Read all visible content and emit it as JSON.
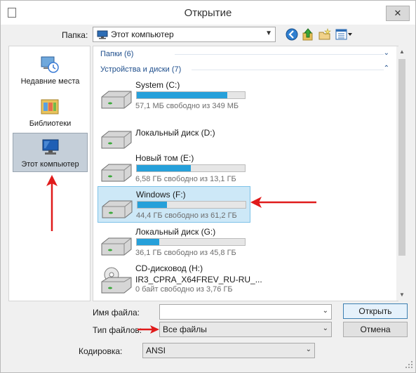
{
  "window": {
    "title": "Открытие",
    "close_label": "✕"
  },
  "location": {
    "label": "Папка:",
    "value": "Этот компьютер"
  },
  "toolbar": {
    "icons": [
      "back-icon",
      "up-folder-icon",
      "new-folder-icon",
      "view-menu-icon"
    ]
  },
  "places": [
    {
      "label": "Недавние места",
      "icon": "recent-places-icon",
      "selected": false
    },
    {
      "label": "Библиотеки",
      "icon": "libraries-icon",
      "selected": false
    },
    {
      "label": "Этот компьютер",
      "icon": "computer-icon",
      "selected": true
    }
  ],
  "groups": {
    "folders": {
      "label": "Папки (6)",
      "collapsed": true
    },
    "devices": {
      "label": "Устройства и диски (7)",
      "collapsed": false
    }
  },
  "drives": [
    {
      "name": "System (C:)",
      "info": "57,1 МБ свободно из 349 МБ",
      "used_fraction": 0.84
    },
    {
      "name": "Локальный диск (D:)"
    },
    {
      "name": "Новый том (E:)",
      "info": "6,58 ГБ свободно из 13,1 ГБ",
      "used_fraction": 0.5
    },
    {
      "name": "Windows (F:)",
      "info": "44,4 ГБ свободно из 61,2 ГБ",
      "used_fraction": 0.27,
      "selected": true
    },
    {
      "name": "Локальный диск (G:)",
      "info": "36,1 ГБ свободно из 45,8 ГБ",
      "used_fraction": 0.21
    },
    {
      "name": "CD-дисковод (H:)",
      "sub": "IR3_CPRA_X64FREV_RU-RU_...",
      "info": "0 байт свободно из 3,76 ГБ"
    }
  ],
  "form": {
    "filename_label": "Имя файла:",
    "filename_value": "",
    "filetype_label": "Тип файлов:",
    "filetype_value": "Все файлы",
    "encoding_label": "Кодировка:",
    "encoding_value": "ANSI"
  },
  "buttons": {
    "open": "Открыть",
    "cancel": "Отмена"
  },
  "colors": {
    "accent": "#26a0da",
    "annotation": "#e01b1b",
    "selection": "#cde8f7"
  }
}
